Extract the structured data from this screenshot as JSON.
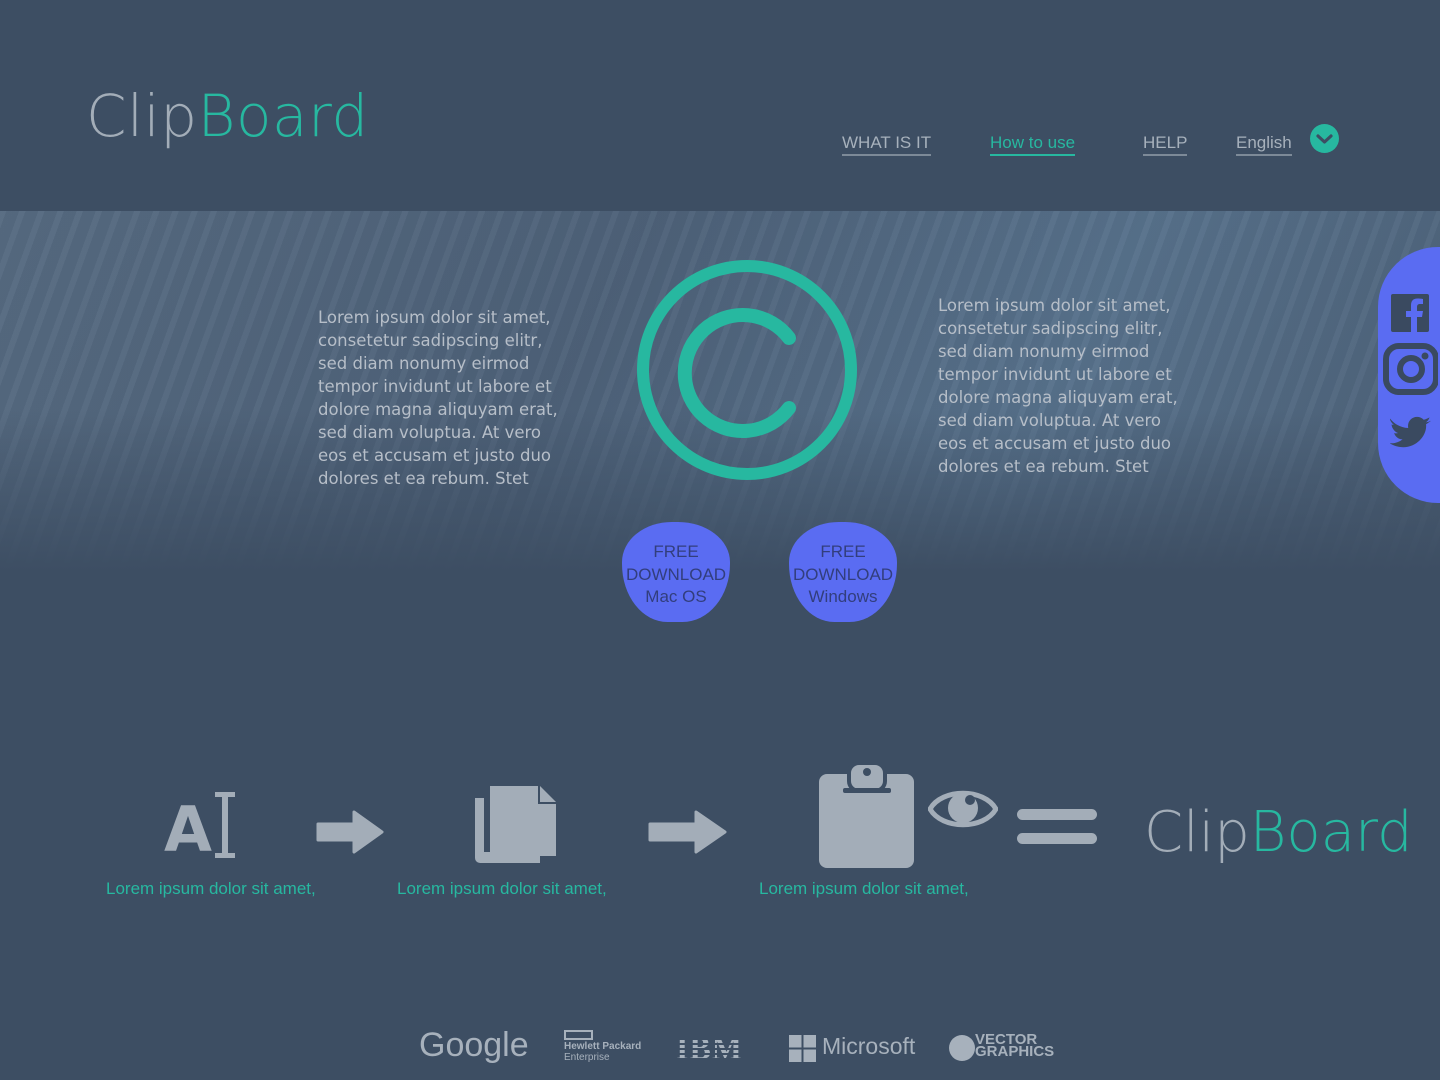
{
  "brand": {
    "part1": "Clip",
    "part2": "Board"
  },
  "nav": {
    "what_is_it": "WHAT IS IT",
    "how_to_use": "How to use",
    "help": "HELP",
    "language": "English"
  },
  "hero": {
    "left_text": "Lorem ipsum dolor sit amet, consetetur sadipscing elitr, sed diam nonumy eirmod tempor invidunt ut labore et dolore magna aliquyam erat, sed diam voluptua. At vero eos et accusam et justo duo dolores et ea rebum. Stet",
    "right_text": "Lorem ipsum dolor sit amet, consetetur sadipscing elitr, sed diam nonumy eirmod tempor invidunt ut labore et dolore magna aliquyam erat, sed diam voluptua. At vero eos et accusam et justo duo dolores et ea rebum. Stet"
  },
  "downloads": {
    "mac": {
      "line1": "FREE",
      "line2": "DOWNLOAD",
      "line3": "Mac OS"
    },
    "windows": {
      "line1": "FREE",
      "line2": "DOWNLOAD",
      "line3": "Windows"
    }
  },
  "social": [
    "facebook-icon",
    "instagram-icon",
    "twitter-icon"
  ],
  "steps": {
    "step1": "Lorem ipsum dolor sit amet,",
    "step2": "Lorem ipsum dolor sit amet,",
    "step3": "Lorem ipsum dolor sit amet,"
  },
  "step_icon_text": "A",
  "partners": {
    "google": "Google",
    "hpe_line1": "Hewlett Packard",
    "hpe_line2": "Enterprise",
    "ibm": "IBM",
    "microsoft": "Microsoft",
    "vector_line1": "VECTOR",
    "vector_line2": "GRAPHICS"
  },
  "colors": {
    "background": "#3d4e63",
    "accent": "#27b8a0",
    "button": "#5a6cf2",
    "muted": "#a3adb8"
  }
}
